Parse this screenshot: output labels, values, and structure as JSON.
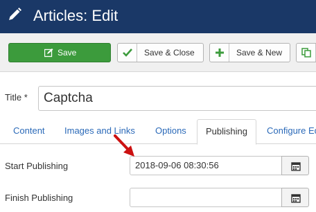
{
  "header": {
    "title": "Articles: Edit",
    "icon": "pencil-icon"
  },
  "toolbar": {
    "save_label": "Save",
    "save_close_label": "Save & Close",
    "save_new_label": "Save & New",
    "colors": {
      "save_bg": "#3c9b3c",
      "check": "#3c9b3c",
      "plus": "#3c9b3c"
    }
  },
  "form": {
    "title_label": "Title *",
    "title_value": "Captcha"
  },
  "tabs": [
    {
      "label": "Content",
      "active": false
    },
    {
      "label": "Images and Links",
      "active": false
    },
    {
      "label": "Options",
      "active": false
    },
    {
      "label": "Publishing",
      "active": true
    },
    {
      "label": "Configure Ed",
      "active": false
    }
  ],
  "publishing": {
    "start_label": "Start Publishing",
    "start_value": "2018-09-06 08:30:56",
    "finish_label": "Finish Publishing",
    "finish_value": ""
  },
  "annotation": {
    "arrow_color": "#cc1111"
  }
}
